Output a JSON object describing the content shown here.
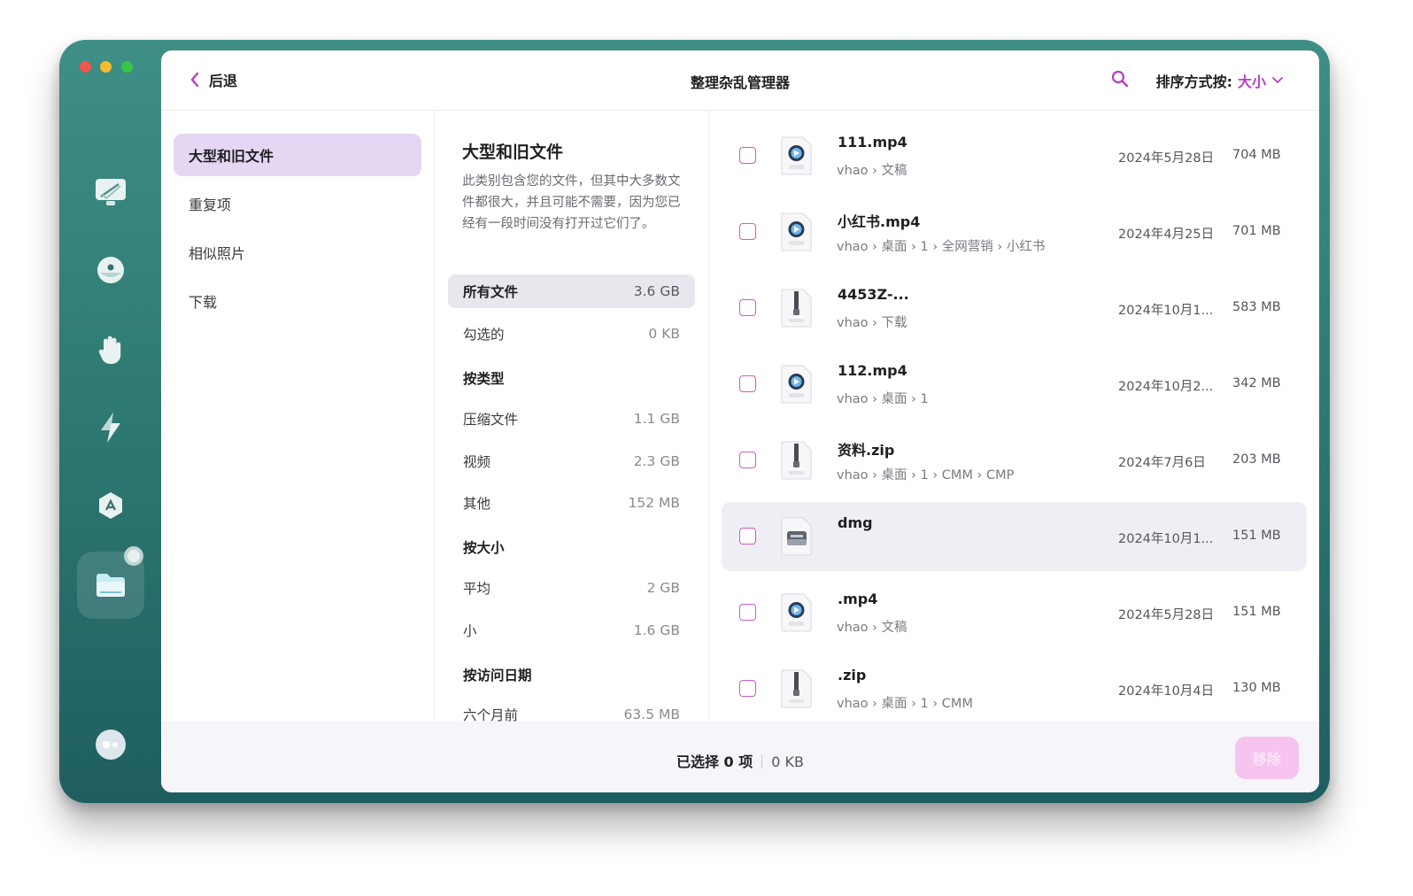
{
  "header": {
    "back_label": "后退",
    "title": "整理杂乱管理器",
    "sort_label": "排序方式按:",
    "sort_value": "大小"
  },
  "nav": {
    "items": [
      {
        "label": "大型和旧文件"
      },
      {
        "label": "重复项"
      },
      {
        "label": "相似照片"
      },
      {
        "label": "下载"
      }
    ]
  },
  "middle": {
    "title": "大型和旧文件",
    "description": "此类别包含您的文件，但其中大多数文件都很大，并且可能不需要，因为您已经有一段时间没有打开过它们了。",
    "all_files": {
      "label": "所有文件",
      "value": "3.6 GB"
    },
    "checked": {
      "label": "勾选的",
      "value": "0 KB"
    },
    "by_type_heading": "按类型",
    "by_type": [
      {
        "label": "压缩文件",
        "value": "1.1 GB"
      },
      {
        "label": "视频",
        "value": "2.3 GB"
      },
      {
        "label": "其他",
        "value": "152 MB"
      }
    ],
    "by_size_heading": "按大小",
    "by_size": [
      {
        "label": "平均",
        "value": "2 GB"
      },
      {
        "label": "小",
        "value": "1.6 GB"
      }
    ],
    "by_date_heading": "按访问日期",
    "by_date": [
      {
        "label": "六个月前",
        "value": "63.5 MB"
      }
    ]
  },
  "files": [
    {
      "name": "111.mp4",
      "path": "vhao › 文稿",
      "date": "2024年5月28日",
      "size": "704 MB",
      "icon": "video-file-icon"
    },
    {
      "name": "小红书.mp4",
      "path": "vhao › 桌面 › 1 › 全网营销 › 小红书",
      "date": "2024年4月25日",
      "size": "701 MB",
      "icon": "video-file-icon"
    },
    {
      "name": "4453Z-...",
      "path": "vhao › 下载",
      "date": "2024年10月1...",
      "size": "583 MB",
      "icon": "zip-file-icon"
    },
    {
      "name": "112.mp4",
      "path": "vhao › 桌面 › 1",
      "date": "2024年10月2...",
      "size": "342 MB",
      "icon": "video-file-icon"
    },
    {
      "name": "资料.zip",
      "path": "vhao › 桌面 › 1 › CMM › CMP",
      "date": "2024年7月6日",
      "size": "203 MB",
      "icon": "zip-file-icon"
    },
    {
      "name": "dmg",
      "path": "",
      "date": "2024年10月1...",
      "size": "151 MB",
      "icon": "disk-image-icon"
    },
    {
      "name": ".mp4",
      "path": "vhao › 文稿",
      "date": "2024年5月28日",
      "size": "151 MB",
      "icon": "video-file-icon"
    },
    {
      "name": ".zip",
      "path": "vhao › 桌面 › 1 › CMM",
      "date": "2024年10月4日",
      "size": "130 MB",
      "icon": "zip-file-icon"
    }
  ],
  "footer": {
    "selected": "已选择 0 项",
    "selected_size": "0 KB",
    "remove_label": "移除"
  },
  "colors": {
    "accent": "#b83dc6",
    "nav_active": "#e5d6f3",
    "window_bg": "#2f7b74"
  }
}
